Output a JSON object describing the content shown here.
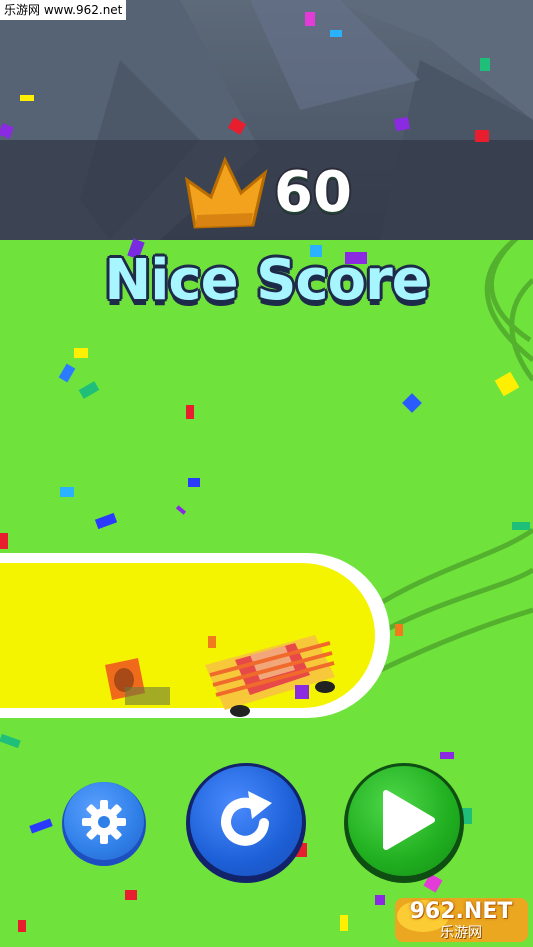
{
  "watermark_top": "乐游网 www.962.net",
  "score": {
    "value": "60",
    "icon": "crown-icon"
  },
  "title": "Nice Score",
  "buttons": [
    {
      "name": "settings-button",
      "icon": "gear-icon",
      "color": "#2f7fe8"
    },
    {
      "name": "restart-button",
      "icon": "restart-icon",
      "color": "#1d5fd6"
    },
    {
      "name": "next-button",
      "icon": "play-icon",
      "color": "#1fae1f"
    }
  ],
  "watermark_logo": {
    "main": "962.NET",
    "sub": "乐游网"
  },
  "colors": {
    "grass": "#6fe33c",
    "track_fill": "#f4f400",
    "title_fill": "#a7f5ff",
    "crown": "#f2a21c"
  }
}
